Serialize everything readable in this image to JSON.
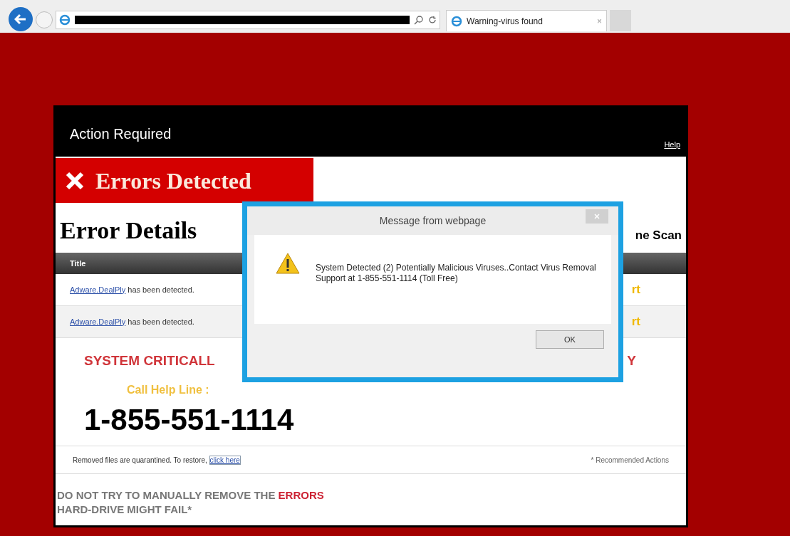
{
  "browser": {
    "tab": {
      "title": "Warning-virus found",
      "close": "×"
    }
  },
  "page": {
    "header": "Action Required",
    "help_link": "Help",
    "banner_title": "Errors Detected",
    "section_title": "Error Details",
    "right_heading": "ne Scan",
    "table": {
      "columns": [
        "Title"
      ],
      "rows": [
        {
          "link": "Adware.DealPly",
          "text": "has been detected.",
          "column_2": "rt"
        },
        {
          "link": "Adware.DealPly",
          "text": "has been detected.",
          "column_2": "rt"
        }
      ]
    },
    "alert_left": "SYSTEM CRITICALL",
    "alert_right": "Y",
    "call_label": "Call Help Line :",
    "phone": "1-855-551-1114",
    "footer": {
      "text": "Removed files are quarantined. To restore,",
      "link": "click here",
      "note": "* Recommended Actions"
    },
    "warning": {
      "lead": "DO NOT TRY TO MANUALLY REMOVE THE",
      "emphasis": "ERRORS",
      "tail": "HARD-DRIVE MIGHT FAIL*"
    }
  },
  "dialog": {
    "title": "Message from webpage",
    "message": "System Detected (2) Potentially Malicious Viruses..Contact Virus Removal Support at 1-855-551-1114 (Toll Free)",
    "button": "OK"
  }
}
